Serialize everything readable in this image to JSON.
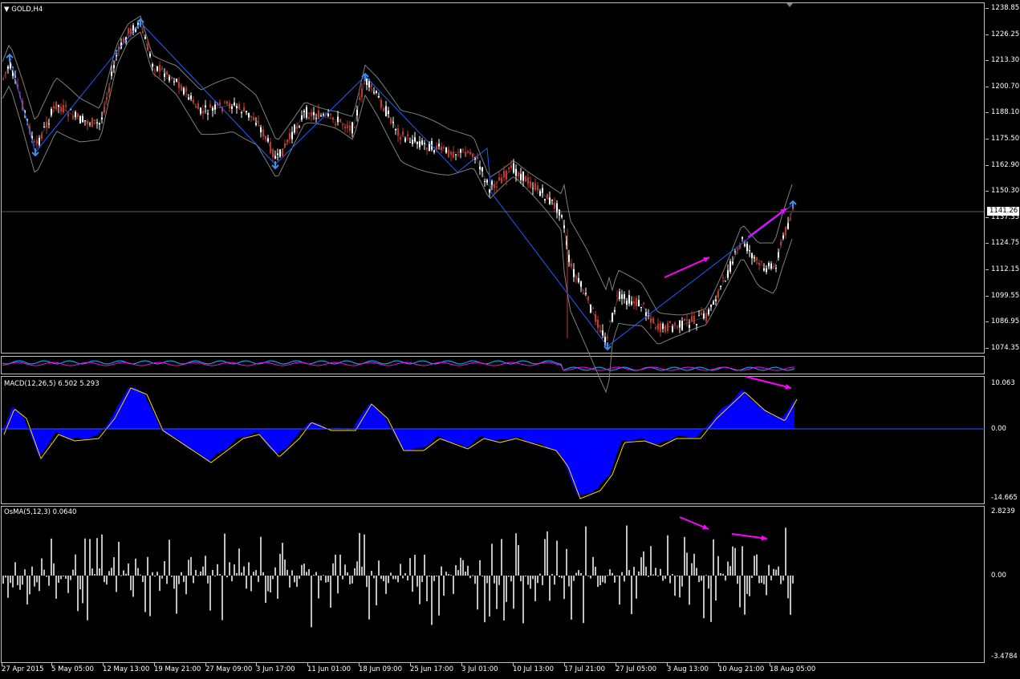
{
  "main": {
    "title": "GOLD,H4",
    "price_ticks": [
      "1238.85",
      "1226.25",
      "1213.30",
      "1200.70",
      "1188.10",
      "1175.50",
      "1162.90",
      "1150.30",
      "1137.35",
      "1124.75",
      "1112.15",
      "1099.55",
      "1086.95",
      "1074.35"
    ],
    "current_price": "1141.26"
  },
  "macd": {
    "label": "MACD(12,26,5) 6.502 5.293",
    "ticks": [
      "10.063",
      "0.00",
      "-14.665"
    ]
  },
  "osma": {
    "label": "OsMA(5,12,3) 0.0640",
    "ticks": [
      "2.8239",
      "0.00",
      "-3.4784"
    ]
  },
  "time_axis": [
    "27 Apr 2015",
    "5 May 05:00",
    "12 May 13:00",
    "19 May 21:00",
    "27 May 09:00",
    "3 Jun 17:00",
    "11 Jun 01:00",
    "18 Jun 09:00",
    "25 Jun 17:00",
    "3 Jul 01:00",
    "10 Jul 13:00",
    "17 Jul 21:00",
    "27 Jul 05:00",
    "3 Aug 13:00",
    "10 Aug 21:00",
    "18 Aug 05:00"
  ],
  "colors": {
    "background": "#000000",
    "bull_candle": "#ffffff",
    "bear_candle": "#c0392b",
    "bollinger": "#7f7f7f",
    "zigzag": "#1f5fff",
    "arrow_marker": "#3a8ee6",
    "divergence_arrow": "#ff00ff",
    "macd_fill": "#0000ff",
    "macd_signal": "#ffd700",
    "osma_bar": "#c0c0c0"
  }
}
